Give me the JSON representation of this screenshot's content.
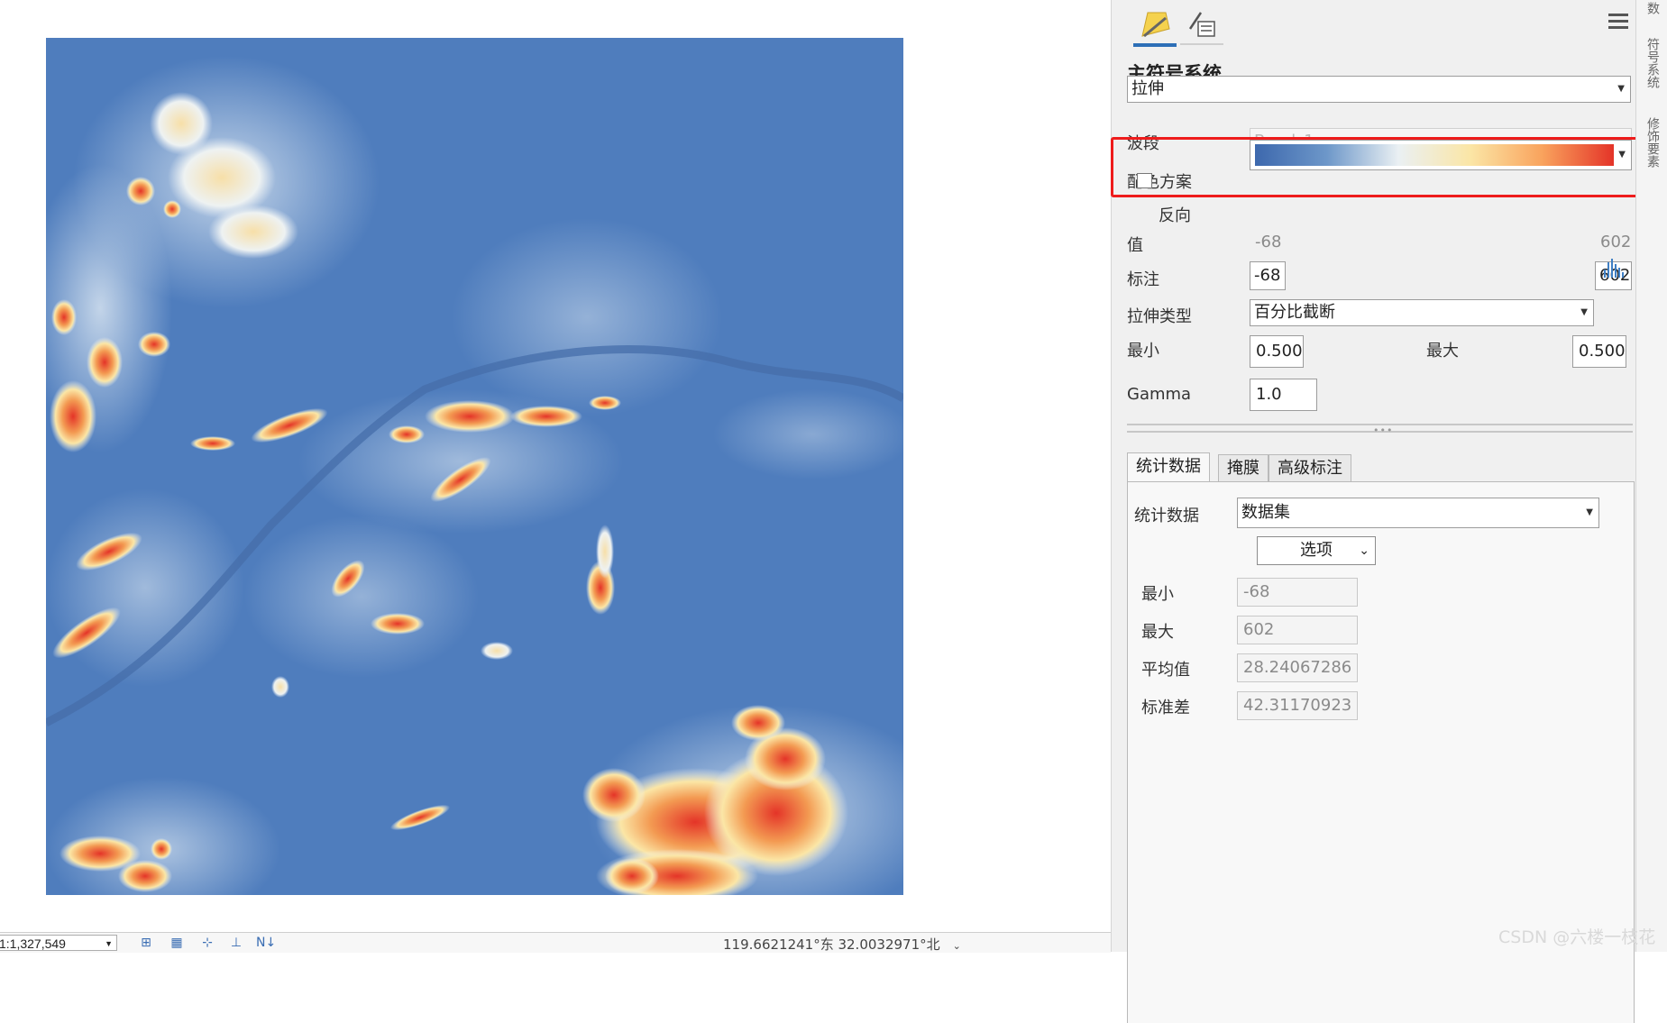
{
  "map": {
    "scale": "1:1,327,549",
    "coordinates": "119.6621241°东 32.0032971°北"
  },
  "symbology": {
    "title": "主符号系统",
    "renderer": "拉伸",
    "band_label": "波段",
    "band_value": "Band_1",
    "color_scheme_label": "配色方案",
    "color_scheme_colors": [
      "#3d68ad",
      "#6d97c9",
      "#eaf0f3",
      "#fbe6a6",
      "#f9a35d",
      "#e43428"
    ],
    "invert_label": "反向",
    "invert_checked": false,
    "value_label": "值",
    "value_min": "-68",
    "value_max": "602",
    "label_label": "标注",
    "label_min": "-68",
    "label_max": "602",
    "stretch_type_label": "拉伸类型",
    "stretch_type": "百分比截断",
    "min_label": "最小",
    "min_value": "0.500",
    "max_label": "最大",
    "max_value": "0.500",
    "gamma_label": "Gamma",
    "gamma_value": "1.0"
  },
  "tabs": [
    "统计数据",
    "掩膜",
    "高级标注"
  ],
  "statistics": {
    "source_label": "统计数据",
    "source_value": "数据集",
    "options_label": "选项",
    "min_label": "最小",
    "min": "-68",
    "max_label": "最大",
    "max": "602",
    "mean_label": "平均值",
    "mean": "28.24067286",
    "std_label": "标准差",
    "std": "42.31170923"
  },
  "side_tabs": [
    "数",
    "符号系统",
    "修饰要素"
  ],
  "watermark": "CSDN @六楼一枝花"
}
